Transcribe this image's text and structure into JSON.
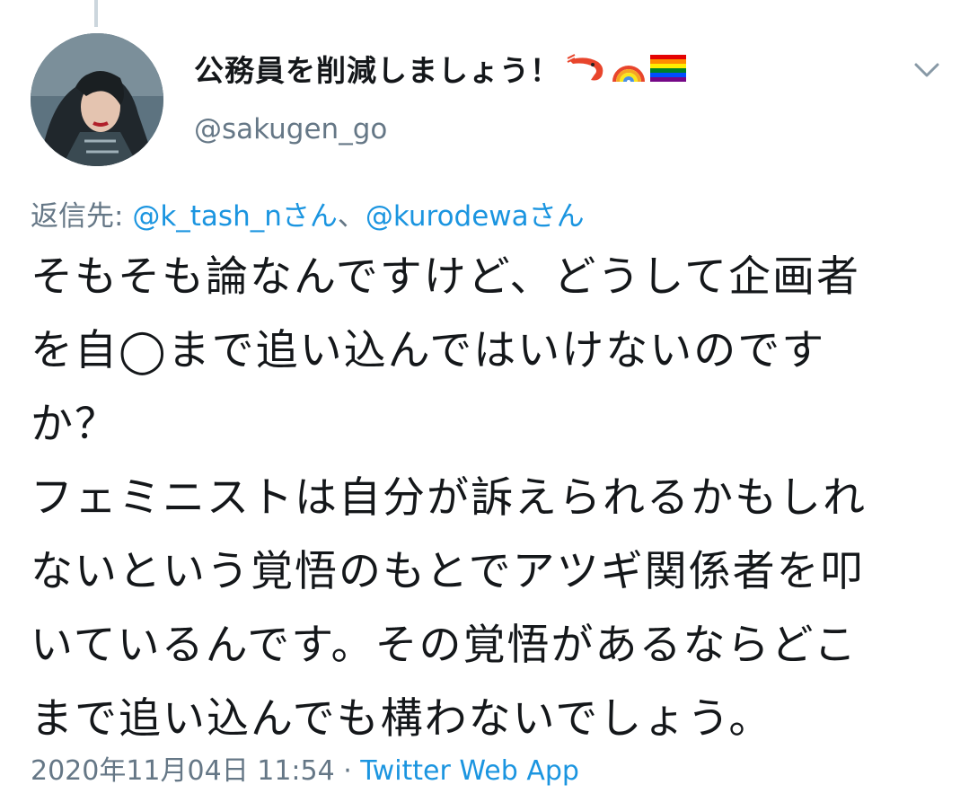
{
  "author": {
    "display_name": "公務員を削減しましょう！",
    "handle": "@sakugen_go",
    "badge_icons": [
      "shrimp-icon",
      "rainbow-icon",
      "rainbow-flag-icon"
    ]
  },
  "reply": {
    "prefix": "返信先: ",
    "mention_1": "@k_tash_nさん",
    "separator": "、",
    "mention_2": "@kurodewaさん"
  },
  "tweet": {
    "lines": [
      "そもそも論なんですけど、どうして企画者",
      "を自◯まで追い込んではいけないのです",
      "か？",
      "フェミニストは自分が訴えられるかもしれ",
      "ないという覚悟のもとでアツギ関係者を叩",
      "いているんです。その覚悟があるならどこ",
      "まで追い込んでも構わないでしょう。"
    ]
  },
  "meta": {
    "timestamp": "2020年11月04日 11:54",
    "separator": " · ",
    "source": "Twitter Web App"
  },
  "colors": {
    "link": "#1b95e0",
    "secondary_text": "#657786",
    "primary_text": "#14171a"
  }
}
